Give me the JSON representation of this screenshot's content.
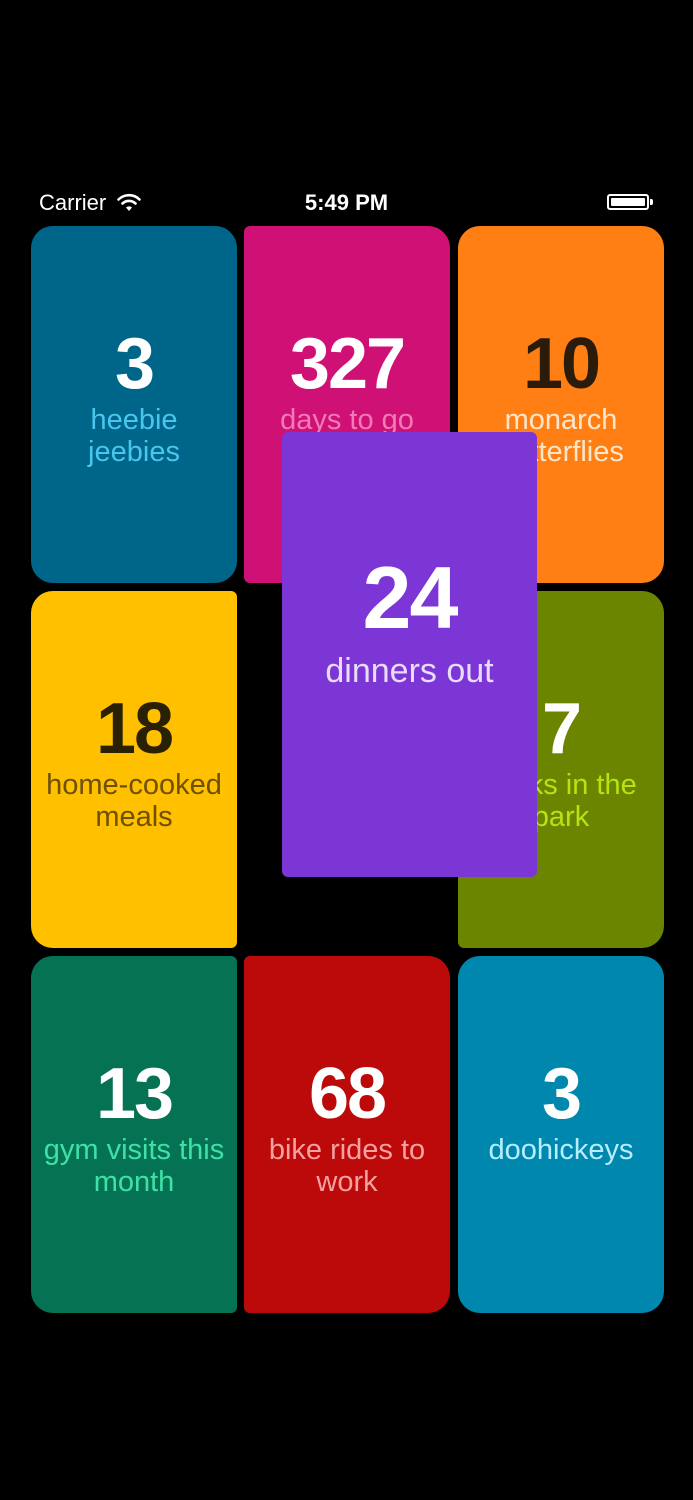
{
  "status_bar": {
    "carrier": "Carrier",
    "time": "5:49 PM",
    "wifi_icon": "wifi-icon",
    "battery_icon": "battery-icon"
  },
  "tiles": [
    {
      "number": "3",
      "label": "heebie jeebies",
      "bg": "#006689",
      "num_color": "#ffffff",
      "label_color": "#48c6ee"
    },
    {
      "number": "327",
      "label": "days to go",
      "bg": "#cf1175",
      "num_color": "#ffffff",
      "label_color": "#f27ab6"
    },
    {
      "number": "10",
      "label": "monarch butterflies",
      "bg": "#ff7f14",
      "num_color": "#2b1b0a",
      "label_color": "#fde6c9"
    },
    {
      "number": "18",
      "label": "home-cooked meals",
      "bg": "#ffc000",
      "num_color": "#2a2105",
      "label_color": "#6e5000"
    },
    {
      "number": "24",
      "label": "dinners out",
      "bg": "#7b36d5",
      "num_color": "#ffffff",
      "label_color": "#e8dcf8"
    },
    {
      "number": "7",
      "label": "walks in the park",
      "bg": "#6b8500",
      "num_color": "#ffffff",
      "label_color": "#b6e411"
    },
    {
      "number": "13",
      "label": "gym visits this month",
      "bg": "#067254",
      "num_color": "#ffffff",
      "label_color": "#3ee1a6"
    },
    {
      "number": "68",
      "label": "bike rides to work",
      "bg": "#bc0a0a",
      "num_color": "#ffffff",
      "label_color": "#f7a0a0"
    },
    {
      "number": "3",
      "label": "doohickeys",
      "bg": "#0087ae",
      "num_color": "#ffffff",
      "label_color": "#b6eeff"
    }
  ]
}
